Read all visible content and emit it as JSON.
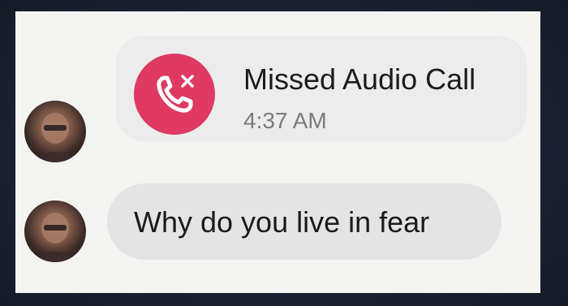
{
  "call": {
    "title": "Missed Audio Call",
    "time": "4:37 AM",
    "icon": "missed-call-icon",
    "accent_color": "#de3a62"
  },
  "message": {
    "text": "Why do you live in fear"
  },
  "colors": {
    "outer_background": "#1b2030",
    "panel_background": "#f4f4f3",
    "bubble_background": "#e4e4e4"
  }
}
